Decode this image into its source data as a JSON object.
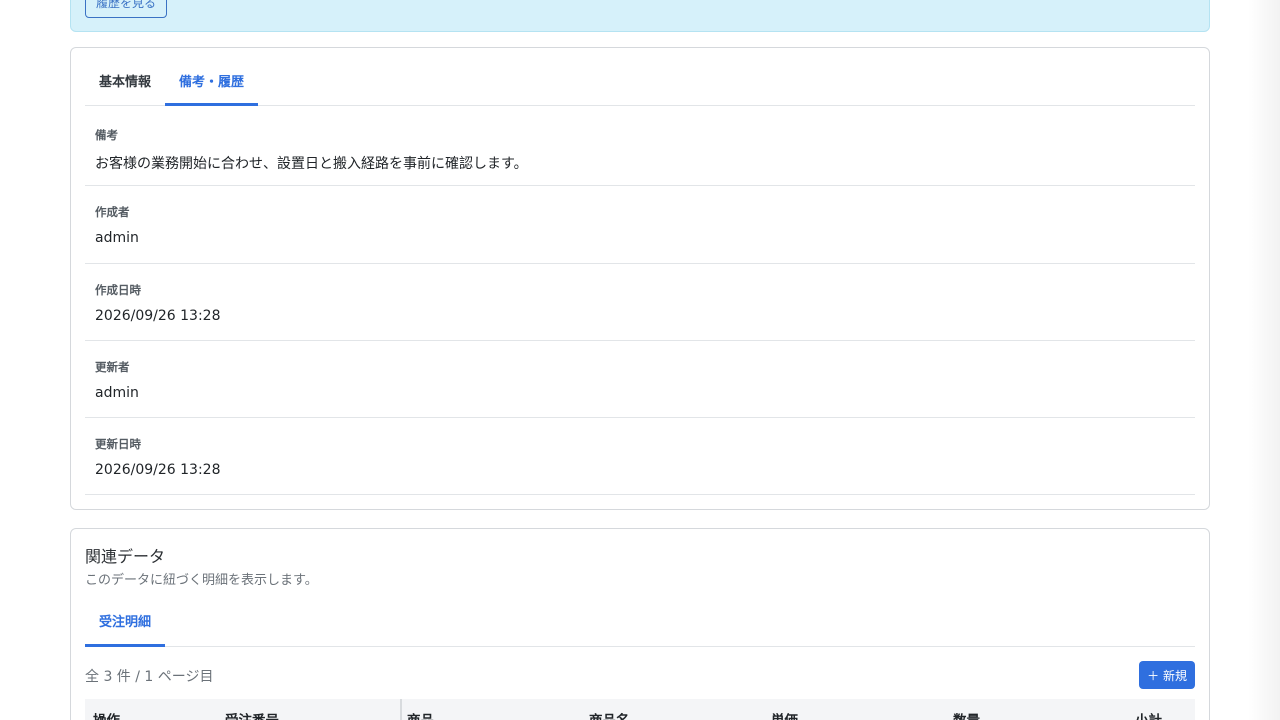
{
  "alert": {
    "history_button": "履歴を見る"
  },
  "detail_tabs": [
    {
      "label": "基本情報",
      "active": false
    },
    {
      "label": "備考・履歴",
      "active": true
    }
  ],
  "fields": [
    {
      "label": "備考",
      "value": "お客様の業務開始に合わせ、設置日と搬入経路を事前に確認します。"
    },
    {
      "label": "作成者",
      "value": "admin"
    },
    {
      "label": "作成日時",
      "value": "2026/09/26 13:28"
    },
    {
      "label": "更新者",
      "value": "admin"
    },
    {
      "label": "更新日時",
      "value": "2026/09/26 13:28"
    }
  ],
  "related": {
    "title": "関連データ",
    "subtitle": "このデータに紐づく明細を表示します。",
    "tab": "受注明細",
    "count_text": "全 3 件 / 1 ページ目",
    "new_button": "＋ 新規",
    "columns": [
      "操作",
      "受注番号",
      "商品",
      "商品名",
      "単価",
      "数量",
      "小計"
    ]
  },
  "colors": {
    "accent": "#2f6fdf",
    "alert_bg": "#d6f1fa"
  }
}
